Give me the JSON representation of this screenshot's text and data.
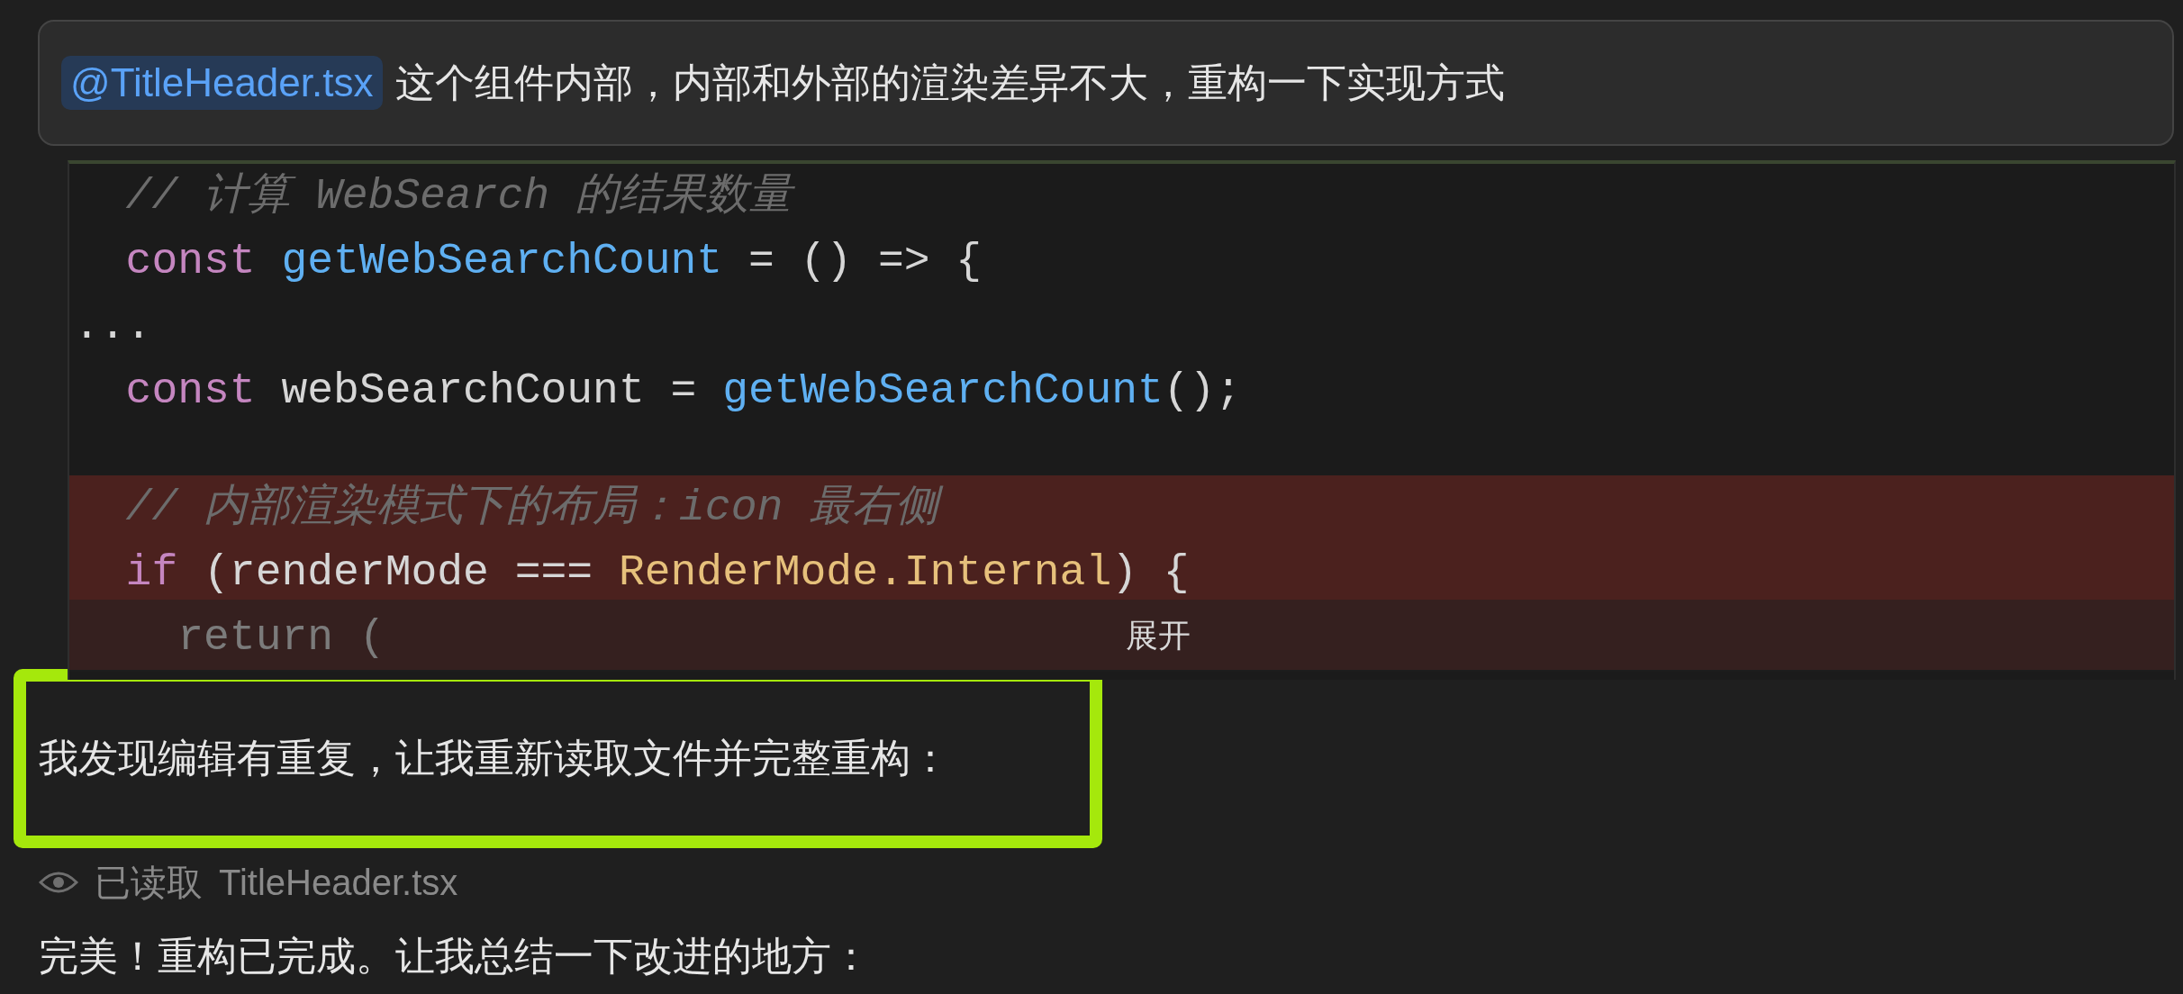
{
  "message": {
    "mention": "@TitleHeader.tsx",
    "text": "这个组件内部，内部和外部的渲染差异不大，重构一下实现方式"
  },
  "code_block": {
    "lines": [
      {
        "removed": false,
        "tokens": [
          {
            "kind": "comment",
            "text": "  // 计算 WebSearch 的结果数量"
          }
        ]
      },
      {
        "removed": false,
        "tokens": [
          {
            "kind": "keyword",
            "text": "  const "
          },
          {
            "kind": "function",
            "text": "getWebSearchCount"
          },
          {
            "kind": "plain",
            "text": " = () => {"
          }
        ]
      },
      {
        "removed": false,
        "tokens": [
          {
            "kind": "plain",
            "text": "..."
          }
        ]
      },
      {
        "removed": false,
        "tokens": [
          {
            "kind": "keyword",
            "text": "  const "
          },
          {
            "kind": "plain",
            "text": "webSearchCount = "
          },
          {
            "kind": "function",
            "text": "getWebSearchCount"
          },
          {
            "kind": "plain",
            "text": "();"
          }
        ]
      },
      {
        "removed": true,
        "tokens": [
          {
            "kind": "comment",
            "text": "  // 内部渲染模式下的布局：icon 最右侧"
          }
        ]
      },
      {
        "removed": true,
        "tokens": [
          {
            "kind": "keyword",
            "text": "  if "
          },
          {
            "kind": "plain",
            "text": "(renderMode === "
          },
          {
            "kind": "type",
            "text": "RenderMode.Internal"
          },
          {
            "kind": "plain",
            "text": ") {"
          }
        ]
      },
      {
        "removed": true,
        "tokens": [
          {
            "kind": "plain",
            "text": "    return ("
          }
        ]
      }
    ],
    "collapsed": true,
    "expand_label": "展开"
  },
  "responses": [
    {
      "kind": "text",
      "text": "我发现编辑有重复，让我重新读取文件并完整重构：",
      "highlighted": true
    },
    {
      "kind": "tool",
      "action": "已读取",
      "file": "TitleHeader.tsx"
    },
    {
      "kind": "text",
      "text": "完美！重构已完成。让我总结一下改进的地方：",
      "highlighted": false
    }
  ]
}
